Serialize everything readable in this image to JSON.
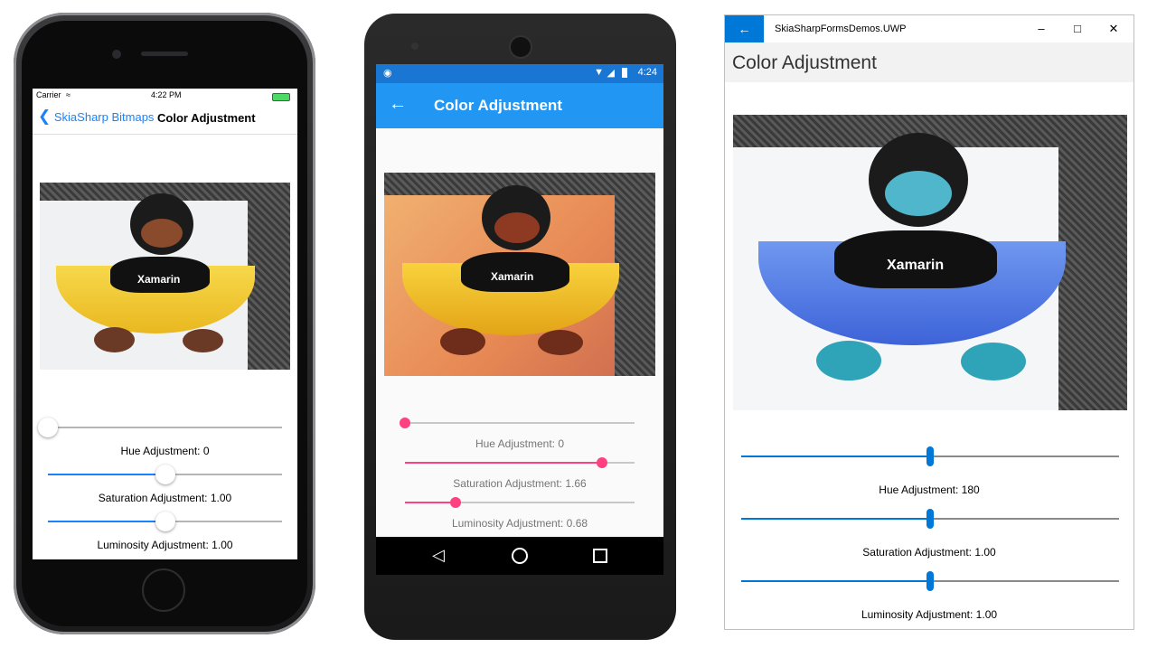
{
  "colors": {
    "ios_blue": "#1a82fb",
    "android_primary": "#2196f3",
    "android_accent": "#ff4081",
    "uwp_accent": "#0078d7"
  },
  "ios": {
    "status": {
      "carrier": "Carrier",
      "time": "4:22 PM"
    },
    "nav": {
      "back_label": "SkiaSharp Bitmaps",
      "title": "Color Adjustment"
    },
    "image_text": "Xamarin",
    "sliders": [
      {
        "label": "Hue Adjustment: 0",
        "level": 0.0
      },
      {
        "label": "Saturation Adjustment: 1.00",
        "level": 0.5
      },
      {
        "label": "Luminosity Adjustment: 1.00",
        "level": 0.5
      }
    ]
  },
  "android": {
    "status": {
      "time": "4:24"
    },
    "toolbar": {
      "title": "Color Adjustment"
    },
    "image_text": "Xamarin",
    "sliders": [
      {
        "label": "Hue Adjustment: 0",
        "level": 0.0
      },
      {
        "label": "Saturation Adjustment: 1.66",
        "level": 0.86
      },
      {
        "label": "Luminosity Adjustment: 0.68",
        "level": 0.22
      }
    ]
  },
  "uwp": {
    "window_title": "SkiaSharpFormsDemos.UWP",
    "page_title": "Color Adjustment",
    "image_text": "Xamarin",
    "sliders": [
      {
        "label": "Hue Adjustment: 180",
        "level": 0.5
      },
      {
        "label": "Saturation Adjustment: 1.00",
        "level": 0.5
      },
      {
        "label": "Luminosity Adjustment: 1.00",
        "level": 0.5
      }
    ]
  }
}
